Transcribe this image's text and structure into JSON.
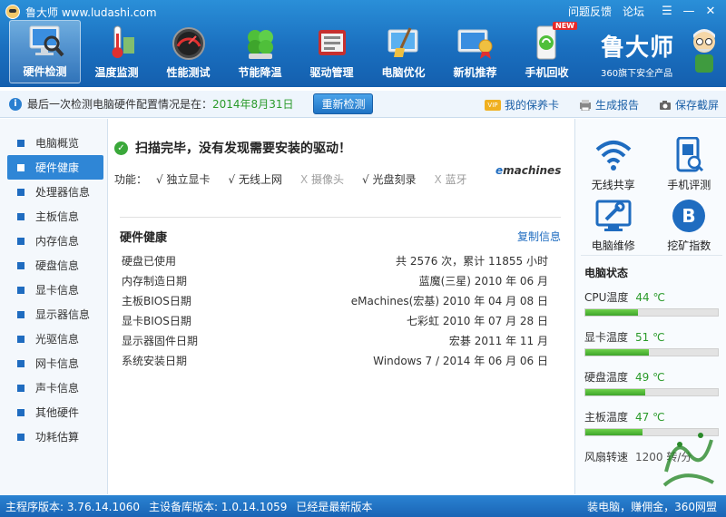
{
  "app": {
    "title": "鲁大师 www.ludashi.com",
    "links": [
      "问题反馈",
      "论坛"
    ],
    "window_buttons": {
      "menu": "☰",
      "minimize": "—",
      "close": "✕"
    }
  },
  "toolbar": {
    "items": [
      {
        "label": "硬件检测",
        "icon": "monitor-magnifier-icon",
        "active": true
      },
      {
        "label": "温度监测",
        "icon": "thermometer-icon"
      },
      {
        "label": "性能测试",
        "icon": "speedometer-icon"
      },
      {
        "label": "节能降温",
        "icon": "clover-icon"
      },
      {
        "label": "驱动管理",
        "icon": "driver-box-icon"
      },
      {
        "label": "电脑优化",
        "icon": "broom-screen-icon"
      },
      {
        "label": "新机推荐",
        "icon": "award-screen-icon"
      },
      {
        "label": "手机回收",
        "icon": "phone-recycle-icon",
        "badge": "NEW"
      }
    ],
    "brand_big": "鲁大师",
    "brand_small": "360旗下安全产品"
  },
  "infobar": {
    "text": "最后一次检测电脑硬件配置情况是在：",
    "date": "2014年8月31日",
    "recheck_label": "重新检测",
    "vip_badge": "VIP",
    "warranty_label": "我的保养卡",
    "report_label": "生成报告",
    "screenshot_label": "保存截屏"
  },
  "sidebar": {
    "items": [
      {
        "label": "电脑概览"
      },
      {
        "label": "硬件健康",
        "active": true
      },
      {
        "label": "处理器信息"
      },
      {
        "label": "主板信息"
      },
      {
        "label": "内存信息"
      },
      {
        "label": "硬盘信息"
      },
      {
        "label": "显卡信息"
      },
      {
        "label": "显示器信息"
      },
      {
        "label": "光驱信息"
      },
      {
        "label": "网卡信息"
      },
      {
        "label": "声卡信息"
      },
      {
        "label": "其他硬件"
      },
      {
        "label": "功耗估算"
      }
    ]
  },
  "main": {
    "scan_title": "扫描完毕，没有发现需要安装的驱动！",
    "features_label": "功能：",
    "features": [
      {
        "label": "独立显卡",
        "on": true
      },
      {
        "label": "无线上网",
        "on": true
      },
      {
        "label": "摄像头",
        "on": false
      },
      {
        "label": "光盘刻录",
        "on": true
      },
      {
        "label": "蓝牙",
        "on": false
      }
    ],
    "brand_logo_prefix": "e",
    "brand_logo_rest": "machines",
    "section_title": "硬件健康",
    "copy_label": "复制信息",
    "rows": [
      {
        "label": "硬盘已使用",
        "value": "共 2576 次，累计 11855 小时"
      },
      {
        "label": "内存制造日期",
        "value": "蓝魔(三星) 2010 年 06 月"
      },
      {
        "label": "主板BIOS日期",
        "value": "eMachines(宏基) 2010 年 04 月 08 日"
      },
      {
        "label": "显卡BIOS日期",
        "value": "七彩虹 2010 年 07 月 28 日"
      },
      {
        "label": "显示器固件日期",
        "value": "宏碁 2011 年 11 月"
      },
      {
        "label": "系统安装日期",
        "value": "Windows 7 / 2014 年 06 月 06 日"
      }
    ]
  },
  "right_panel": {
    "tools": [
      {
        "label": "无线共享",
        "icon": "wifi-icon"
      },
      {
        "label": "手机评测",
        "icon": "phone-scan-icon"
      },
      {
        "label": "电脑维修",
        "icon": "wrench-monitor-icon"
      },
      {
        "label": "挖矿指数",
        "icon": "bitcoin-icon"
      }
    ],
    "status_title": "电脑状态",
    "temps": [
      {
        "label": "CPU温度",
        "value": "44 ℃",
        "level": 0.4
      },
      {
        "label": "显卡温度",
        "value": "51 ℃",
        "level": 0.48
      },
      {
        "label": "硬盘温度",
        "value": "49 ℃",
        "level": 0.45
      },
      {
        "label": "主板温度",
        "value": "47 ℃",
        "level": 0.43
      }
    ],
    "fan_label": "风扇转速",
    "fan_value": "1200 转/分"
  },
  "statusbar": {
    "main_version": "主程序版本: 3.76.14.1060",
    "db_version": "主设备库版本: 1.0.14.1059",
    "latest": "已经是最新版本",
    "right": "装电脑，赚佣金，360网盟"
  },
  "colors": {
    "header_blue": "#1a6fbf",
    "accent_blue": "#2f86d6",
    "ok_green": "#2a9a2a"
  }
}
